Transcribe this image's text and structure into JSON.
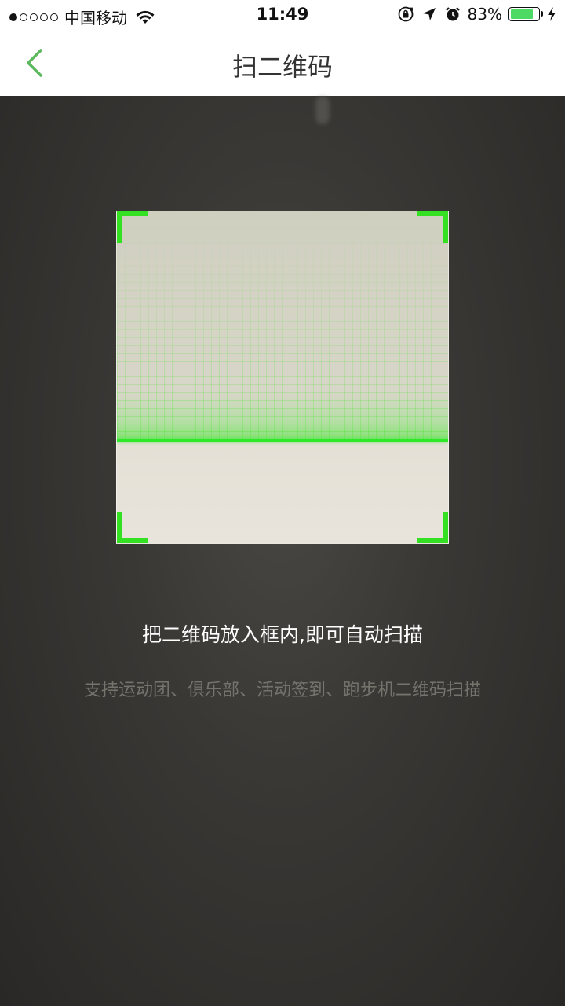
{
  "status_bar": {
    "carrier": "中国移动",
    "time": "11:49",
    "battery_percent": "83%",
    "battery_level": 0.83,
    "signal_bars": 1,
    "icons": [
      "wifi-icon",
      "orientation-lock-icon",
      "location-arrow-icon",
      "alarm-icon",
      "battery-icon",
      "charging-bolt-icon"
    ]
  },
  "nav": {
    "title": "扫二维码",
    "back_icon": "chevron-left-icon"
  },
  "scanner": {
    "instruction": "把二维码放入框内,即可自动扫描",
    "supported": "支持运动团、俱乐部、活动签到、跑步机二维码扫描"
  },
  "colors": {
    "accent_green": "#33e022",
    "back_green": "#5cb85c",
    "battery_green": "#4cd964"
  }
}
